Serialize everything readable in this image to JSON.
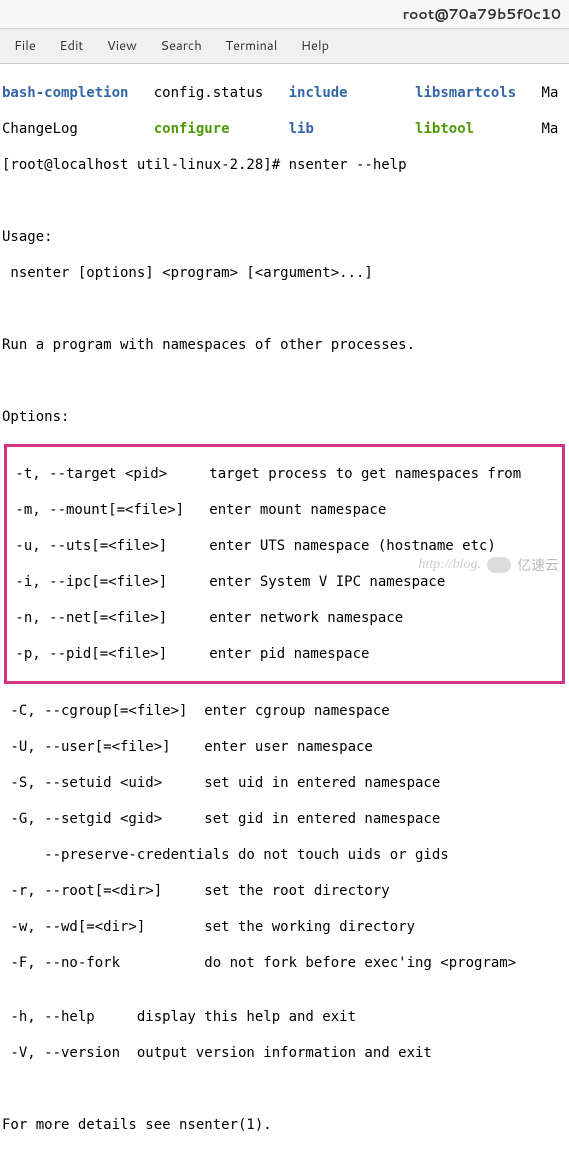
{
  "titlebar": {
    "text": "root@70a79b5f0c10"
  },
  "menubar": {
    "items": [
      "File",
      "Edit",
      "View",
      "Search",
      "Terminal",
      "Help"
    ]
  },
  "listing": {
    "row1": {
      "col1": "bash-completion",
      "col2": "config.status",
      "col3": "include",
      "col4": "libsmartcols",
      "col5": "Ma"
    },
    "row2": {
      "col1": "ChangeLog",
      "col2": "configure",
      "col3": "lib",
      "col4": "libtool",
      "col5": "Ma"
    }
  },
  "prompt": {
    "text": "[root@localhost util-linux-2.28]# ",
    "command": "nsenter --help"
  },
  "usage": {
    "header": "Usage:",
    "line": " nsenter [options] <program> [<argument>...]"
  },
  "description": "Run a program with namespaces of other processes.",
  "options_header": "Options:",
  "boxed_options": {
    "l1": " -t, --target <pid>     target process to get namespaces from",
    "l2": " -m, --mount[=<file>]   enter mount namespace",
    "l3": " -u, --uts[=<file>]     enter UTS namespace (hostname etc)",
    "l4": " -i, --ipc[=<file>]     enter System V IPC namespace",
    "l5": " -n, --net[=<file>]     enter network namespace",
    "l6": " -p, --pid[=<file>]     enter pid namespace"
  },
  "more_options": {
    "l1": " -C, --cgroup[=<file>]  enter cgroup namespace",
    "l2": " -U, --user[=<file>]    enter user namespace",
    "l3": " -S, --setuid <uid>     set uid in entered namespace",
    "l4": " -G, --setgid <gid>     set gid in entered namespace",
    "l5": "     --preserve-credentials do not touch uids or gids",
    "l6": " -r, --root[=<dir>]     set the root directory",
    "l7": " -w, --wd[=<dir>]       set the working directory",
    "l8": " -F, --no-fork          do not fork before exec'ing <program>",
    "l9": "",
    "l10": " -h, --help     display this help and exit",
    "l11": " -V, --version  output version information and exit"
  },
  "footer": "For more details see nsenter(1).",
  "watermark": {
    "text1": "http://blog.",
    "text2": "亿速云"
  }
}
